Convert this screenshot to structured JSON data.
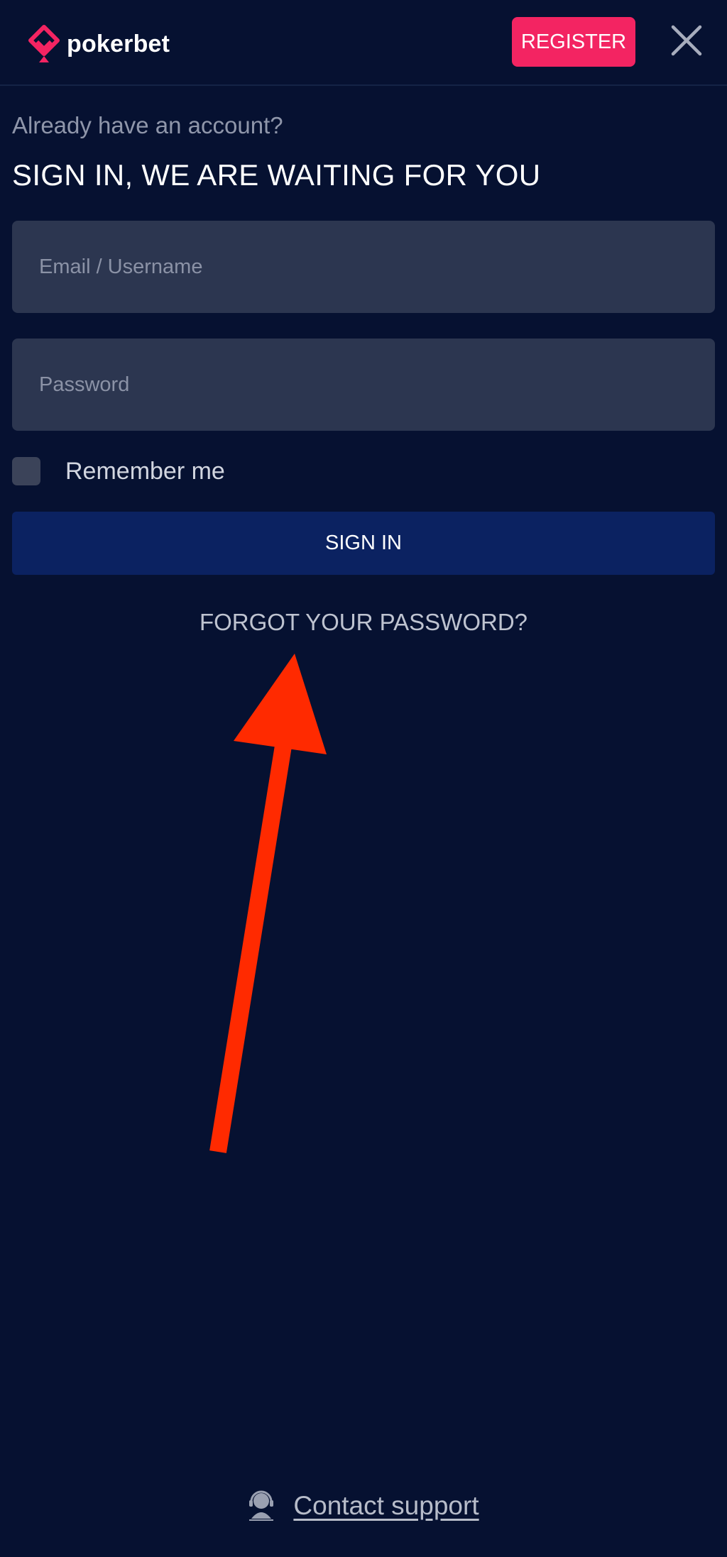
{
  "header": {
    "logo_text": "pokerbet",
    "register_label": "REGISTER",
    "icons": {
      "logo": "pokerbet-logo-icon",
      "close": "close-icon"
    }
  },
  "form": {
    "subtitle": "Already have an account?",
    "title": "SIGN IN, WE ARE WAITING FOR YOU",
    "email": {
      "placeholder": "Email / Username",
      "value": ""
    },
    "password": {
      "placeholder": "Password",
      "value": ""
    },
    "remember_label": "Remember me",
    "remember_checked": false,
    "signin_label": "SIGN IN",
    "forgot_label": "FORGOT YOUR PASSWORD?"
  },
  "annotation": {
    "icon": "red-arrow-annotation",
    "color": "#ff2a00"
  },
  "footer": {
    "support_label": "Contact support",
    "support_icon": "support-agent-icon"
  },
  "colors": {
    "background": "#061131",
    "accent": "#f32462",
    "primary_button": "#0b2261",
    "input_bg": "#2c3650"
  }
}
